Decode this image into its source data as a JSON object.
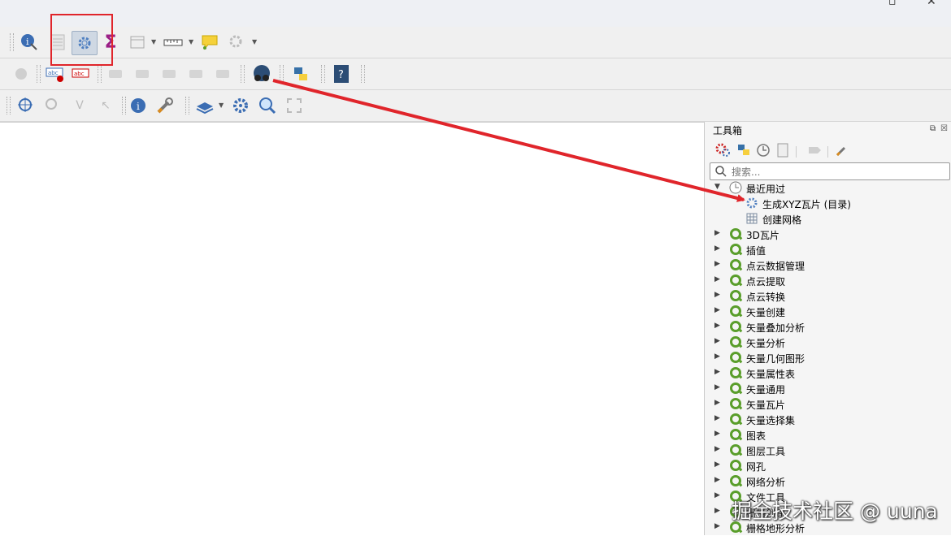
{
  "window": {
    "restore_icon": "restore-window-icon",
    "close_icon": "close-window-icon"
  },
  "toolbar1": {
    "icons": [
      "identify-features-icon",
      "attribute-table-icon",
      "processing-toolbox-icon",
      "statistical-summary-icon",
      "open-table-icon",
      "measure-icon",
      "map-tips-icon",
      "settings-icon"
    ]
  },
  "toolbar2": {
    "icons": [
      "label-pin-icon",
      "label-highlight-icon",
      "label-show-icon",
      "label-move-icon",
      "label-rotate-icon",
      "label-change-icon",
      "plugin-icon",
      "python-console-icon",
      "help-icon"
    ]
  },
  "toolbar3": {
    "icons": [
      "digitize-icon",
      "vertex-tool-icon",
      "snapping-icon",
      "identify-info-icon",
      "wrench-icon",
      "layer-styling-icon",
      "gear-icon",
      "zoom-icon",
      "full-extent-icon"
    ]
  },
  "panel": {
    "title": "工具箱",
    "search_placeholder": "搜索...",
    "recent_label": "最近用过",
    "recent_items": [
      "生成XYZ瓦片 (目录)",
      "创建网格"
    ],
    "groups": [
      "3D瓦片",
      "插值",
      "点云数据管理",
      "点云提取",
      "点云转换",
      "矢量创建",
      "矢量叠加分析",
      "矢量分析",
      "矢量几何图形",
      "矢量属性表",
      "矢量通用",
      "矢量瓦片",
      "矢量选择集",
      "图表",
      "图层工具",
      "网孔",
      "网络分析",
      "文件工具",
      "栅格创建",
      "栅格地形分析"
    ]
  },
  "annotation": {
    "highlight_color": "#e0252b"
  },
  "watermark": "掘金技术社区 @ uuna"
}
